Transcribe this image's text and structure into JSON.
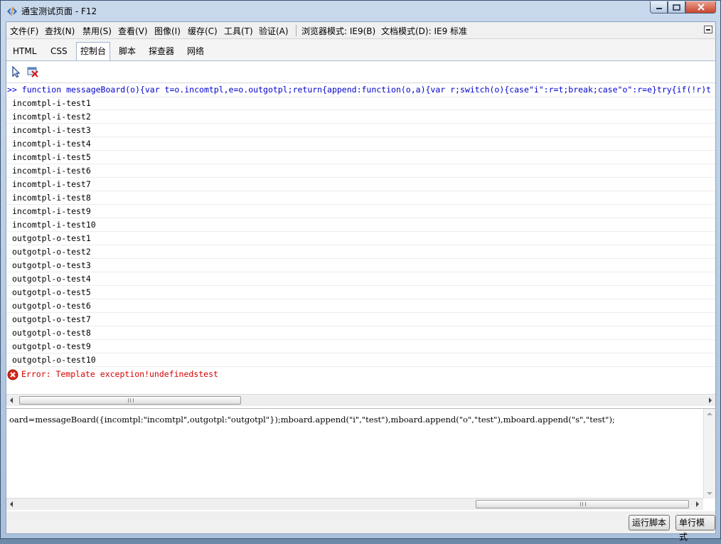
{
  "window": {
    "title": "通宝测试页面 - F12"
  },
  "menu": {
    "items": [
      "文件(F)",
      "查找(N)",
      "禁用(S)",
      "查看(V)",
      "图像(I)",
      "缓存(C)",
      "工具(T)",
      "验证(A)"
    ],
    "browser_mode": "浏览器模式: IE9(B)",
    "document_mode": "文档模式(D): IE9 标准"
  },
  "tabs": [
    {
      "label": "HTML"
    },
    {
      "label": "CSS"
    },
    {
      "label": "控制台",
      "active": true
    },
    {
      "label": "脚本"
    },
    {
      "label": "探查器"
    },
    {
      "label": "网络"
    }
  ],
  "toolbar": {
    "icons": [
      "pointer-select-icon",
      "clear-console-icon"
    ]
  },
  "console": {
    "command": ">> function messageBoard(o){var t=o.incomtpl,e=o.outgotpl;return{append:function(o,a){var r;switch(o){case\"i\":r=t;break;case\"o\":r=e}try{if(!r)t",
    "outputs": [
      "incomtpl-i-test1",
      "incomtpl-i-test2",
      "incomtpl-i-test3",
      "incomtpl-i-test4",
      "incomtpl-i-test5",
      "incomtpl-i-test6",
      "incomtpl-i-test7",
      "incomtpl-i-test8",
      "incomtpl-i-test9",
      "incomtpl-i-test10",
      "outgotpl-o-test1",
      "outgotpl-o-test2",
      "outgotpl-o-test3",
      "outgotpl-o-test4",
      "outgotpl-o-test5",
      "outgotpl-o-test6",
      "outgotpl-o-test7",
      "outgotpl-o-test8",
      "outgotpl-o-test9",
      "outgotpl-o-test10"
    ],
    "error": "Error: Template exception!undefinedstest"
  },
  "input": {
    "text": "oard=messageBoard({incomtpl:\"incomtpl\",outgotpl:\"outgotpl\"});mboard.append(\"i\",\"test\"),mboard.append(\"o\",\"test\"),mboard.append(\"s\",\"test\");"
  },
  "buttons": {
    "run": "运行脚本",
    "single_line": "单行模式"
  }
}
